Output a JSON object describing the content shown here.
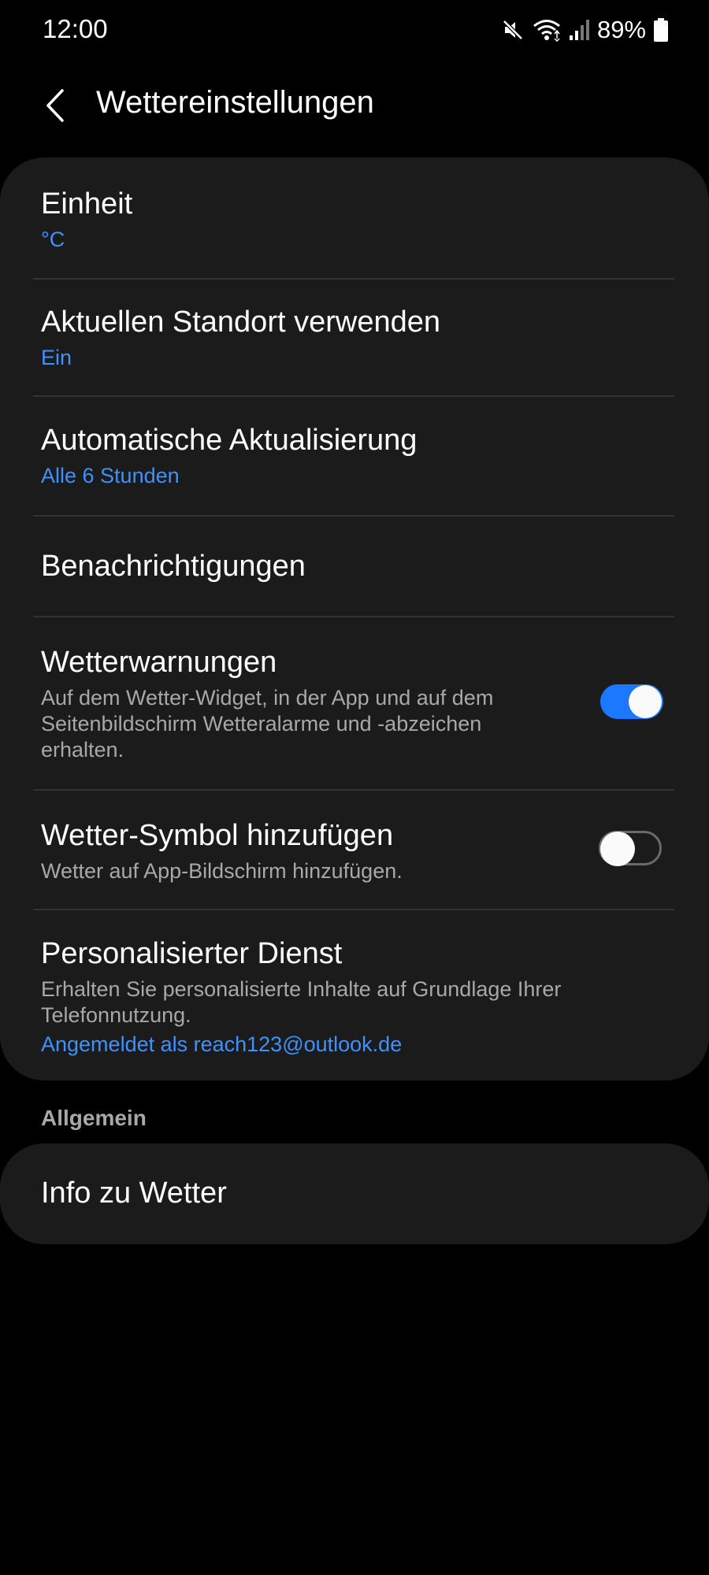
{
  "status_bar": {
    "time": "12:00",
    "battery_percent": "89%",
    "icons": [
      "mute-icon",
      "wifi-icon",
      "signal-icon",
      "battery-icon"
    ]
  },
  "header": {
    "title": "Wettereinstellungen",
    "back_icon": "chevron-left-icon"
  },
  "settings": {
    "unit": {
      "title": "Einheit",
      "value": "°C"
    },
    "location": {
      "title": "Aktuellen Standort verwenden",
      "value": "Ein"
    },
    "auto_update": {
      "title": "Automatische Aktualisierung",
      "value": "Alle 6 Stunden"
    },
    "notifications": {
      "title": "Benachrichtigungen"
    },
    "warnings": {
      "title": "Wetterwarnungen",
      "line1": "Auf dem Wetter-Widget, in der App und auf dem",
      "line2": "Seitenbildschirm Wetteralarme und -abzeichen",
      "line3": "erhalten.",
      "enabled": true
    },
    "weather_icon": {
      "title": "Wetter-Symbol hinzufügen",
      "description": "Wetter auf App-Bildschirm hinzufügen.",
      "enabled": false
    },
    "personalized": {
      "title": "Personalisierter Dienst",
      "line1": "Erhalten Sie personalisierte Inhalte auf Grundlage Ihrer",
      "line2": "Telefonnutzung.",
      "account": "Angemeldet als reach123@outlook.de"
    }
  },
  "general": {
    "section_label": "Allgemein",
    "about": "Info zu Wetter"
  },
  "colors": {
    "background": "#000000",
    "card": "#1b1b1b",
    "accent": "#3e91ff",
    "toggle_on": "#1c78ff",
    "secondary_text": "#a8a8a8"
  }
}
